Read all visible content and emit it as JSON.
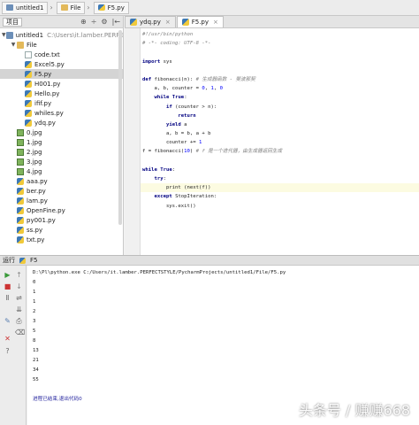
{
  "breadcrumb": [
    "untitled1",
    "File",
    "F5.py"
  ],
  "sidebar": {
    "view_label": "项目",
    "tree": [
      {
        "label": "untitled1",
        "path": "C:\\Users\\it.lamber.PERFEC",
        "depth": 0,
        "expanded": true,
        "icon": "project-folder-icon"
      },
      {
        "label": "File",
        "depth": 1,
        "expanded": true,
        "icon": "folder-icon"
      },
      {
        "label": "code.txt",
        "depth": 2,
        "icon": "text-file-icon"
      },
      {
        "label": "Excel5.py",
        "depth": 2,
        "icon": "python-file-icon"
      },
      {
        "label": "F5.py",
        "depth": 2,
        "icon": "python-file-icon",
        "selected": true
      },
      {
        "label": "H001.py",
        "depth": 2,
        "icon": "python-file-icon"
      },
      {
        "label": "Hello.py",
        "depth": 2,
        "icon": "python-file-icon"
      },
      {
        "label": "ifif.py",
        "depth": 2,
        "icon": "python-file-icon"
      },
      {
        "label": "whiles.py",
        "depth": 2,
        "icon": "python-file-icon"
      },
      {
        "label": "ydq.py",
        "depth": 2,
        "icon": "python-file-icon"
      },
      {
        "label": "0.jpg",
        "depth": 1,
        "icon": "image-file-icon"
      },
      {
        "label": "1.jpg",
        "depth": 1,
        "icon": "image-file-icon"
      },
      {
        "label": "2.jpg",
        "depth": 1,
        "icon": "image-file-icon"
      },
      {
        "label": "3.jpg",
        "depth": 1,
        "icon": "image-file-icon"
      },
      {
        "label": "4.jpg",
        "depth": 1,
        "icon": "image-file-icon"
      },
      {
        "label": "aaa.py",
        "depth": 1,
        "icon": "python-file-icon"
      },
      {
        "label": "ber.py",
        "depth": 1,
        "icon": "python-file-icon"
      },
      {
        "label": "lam.py",
        "depth": 1,
        "icon": "python-file-icon"
      },
      {
        "label": "OpenFine.py",
        "depth": 1,
        "icon": "python-file-icon"
      },
      {
        "label": "py001.py",
        "depth": 1,
        "icon": "python-file-icon"
      },
      {
        "label": "ss.py",
        "depth": 1,
        "icon": "python-file-icon"
      },
      {
        "label": "txt.py",
        "depth": 1,
        "icon": "python-file-icon"
      }
    ]
  },
  "editor": {
    "tabs": [
      {
        "label": "ydq.py",
        "active": false
      },
      {
        "label": "F5.py",
        "active": true
      }
    ],
    "code_lines": [
      "#!/usr/bin/python",
      "# -*- coding: UTF-8 -*-",
      "",
      "import sys",
      "",
      "def fibonacci(n): # 生成器函数 - 斐波那契",
      "    a, b, counter = 0, 1, 0",
      "    while True:",
      "        if (counter > n):",
      "            return",
      "        yield a",
      "        a, b = b, a + b",
      "        counter += 1",
      "f = fibonacci(10) # f 是一个迭代器，由生成器返回生成",
      "",
      "while True:",
      "    try:",
      "        print (next(f))",
      "    except StopIteration:",
      "        sys.exit()"
    ],
    "highlight_line": 17
  },
  "run": {
    "title": "运行",
    "config": "F5",
    "command": "D:\\Pl\\python.exe C:/Users/it.lamber.PERFECTSTYLE/PycharmProjects/untitled1/File/F5.py",
    "output": [
      "0",
      "1",
      "1",
      "2",
      "3",
      "5",
      "8",
      "13",
      "21",
      "34",
      "55"
    ],
    "exit_message": "进程已结束,退出代码0"
  },
  "watermark": "头条号 / 赚赚668",
  "colors": {
    "keyword": "#000080",
    "comment": "#808080",
    "number": "#0000ff",
    "selection": "#d4d4d4"
  }
}
